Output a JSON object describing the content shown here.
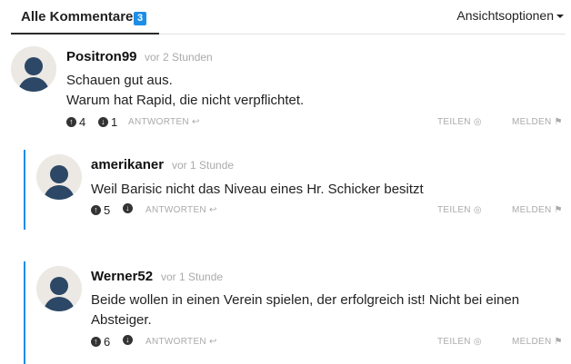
{
  "tabs": {
    "all_comments_label": "Alle Kommentare",
    "count": "3",
    "view_options_label": "Ansichtsoptionen"
  },
  "actions": {
    "reply": "ANTWORTEN",
    "share": "TEILEN",
    "report": "MELDEN"
  },
  "icons": {
    "upvote": "arrow-up-circle-icon",
    "downvote": "arrow-down-circle-icon",
    "reply": "reply-arrow-icon",
    "share": "eye-icon",
    "report": "flag-icon"
  },
  "colors": {
    "accent": "#1c8ee8",
    "avatar_figure": "#2c4866"
  },
  "comments": [
    {
      "author": "Positron99",
      "time": "vor 2 Stunden",
      "lines": [
        "Schauen gut aus.",
        "Warum hat Rapid, die nicht verpflichtet."
      ],
      "upvotes": "4",
      "downvotes": "1"
    },
    {
      "author": "amerikaner",
      "time": "vor 1 Stunde",
      "lines": [
        "Weil Barisic nicht das Niveau eines Hr. Schicker besitzt"
      ],
      "upvotes": "5",
      "downvotes": ""
    },
    {
      "author": "Werner52",
      "time": "vor 1 Stunde",
      "lines": [
        "Beide wollen in einen Verein spielen, der erfolgreich ist! Nicht bei einen",
        "Absteiger."
      ],
      "upvotes": "6",
      "downvotes": ""
    }
  ]
}
